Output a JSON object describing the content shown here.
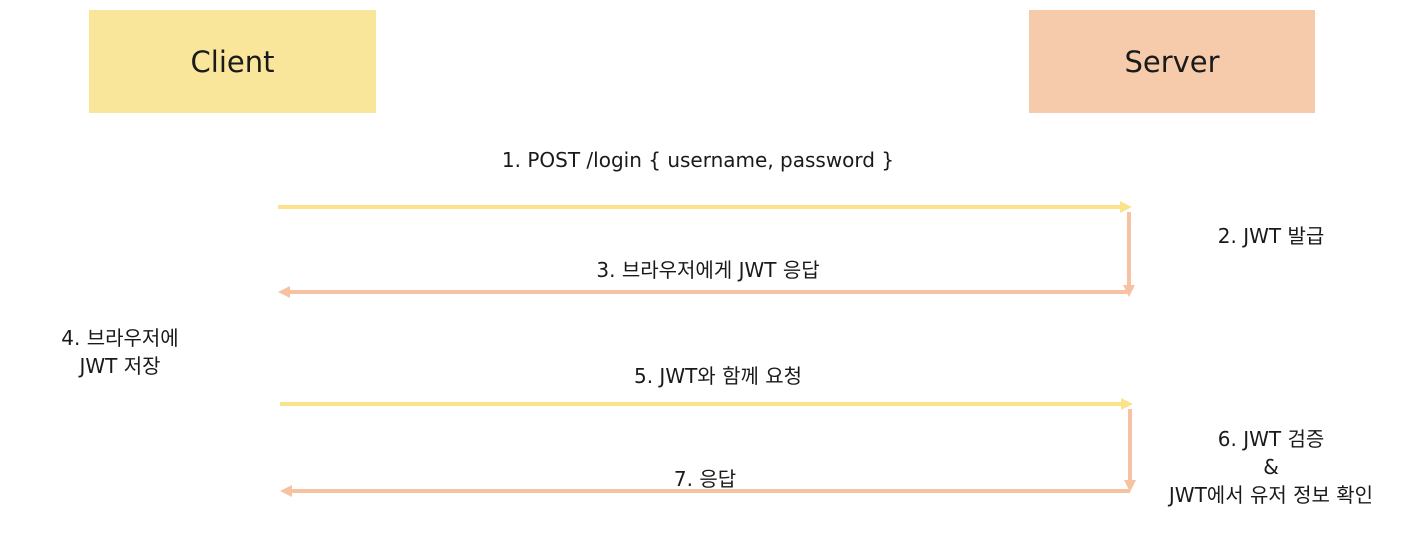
{
  "actors": {
    "client": "Client",
    "server": "Server"
  },
  "steps": {
    "step1": "1. POST /login { username, password }",
    "step2": "2. JWT 발급",
    "step3": "3. 브라우저에게  JWT 응답",
    "step4": [
      "4. 브라우저에",
      "JWT 저장"
    ],
    "step5": "5. JWT와 함께 요청",
    "step6": [
      "6. JWT 검증",
      "&",
      "JWT에서 유저 정보 확인"
    ],
    "step7": "7. 응답"
  },
  "colors": {
    "client": "#fae69b",
    "server": "#f6cbab",
    "request_arrow": "#fbe38c",
    "response_arrow": "#f6c2a2",
    "text": "#1a1a1a"
  }
}
